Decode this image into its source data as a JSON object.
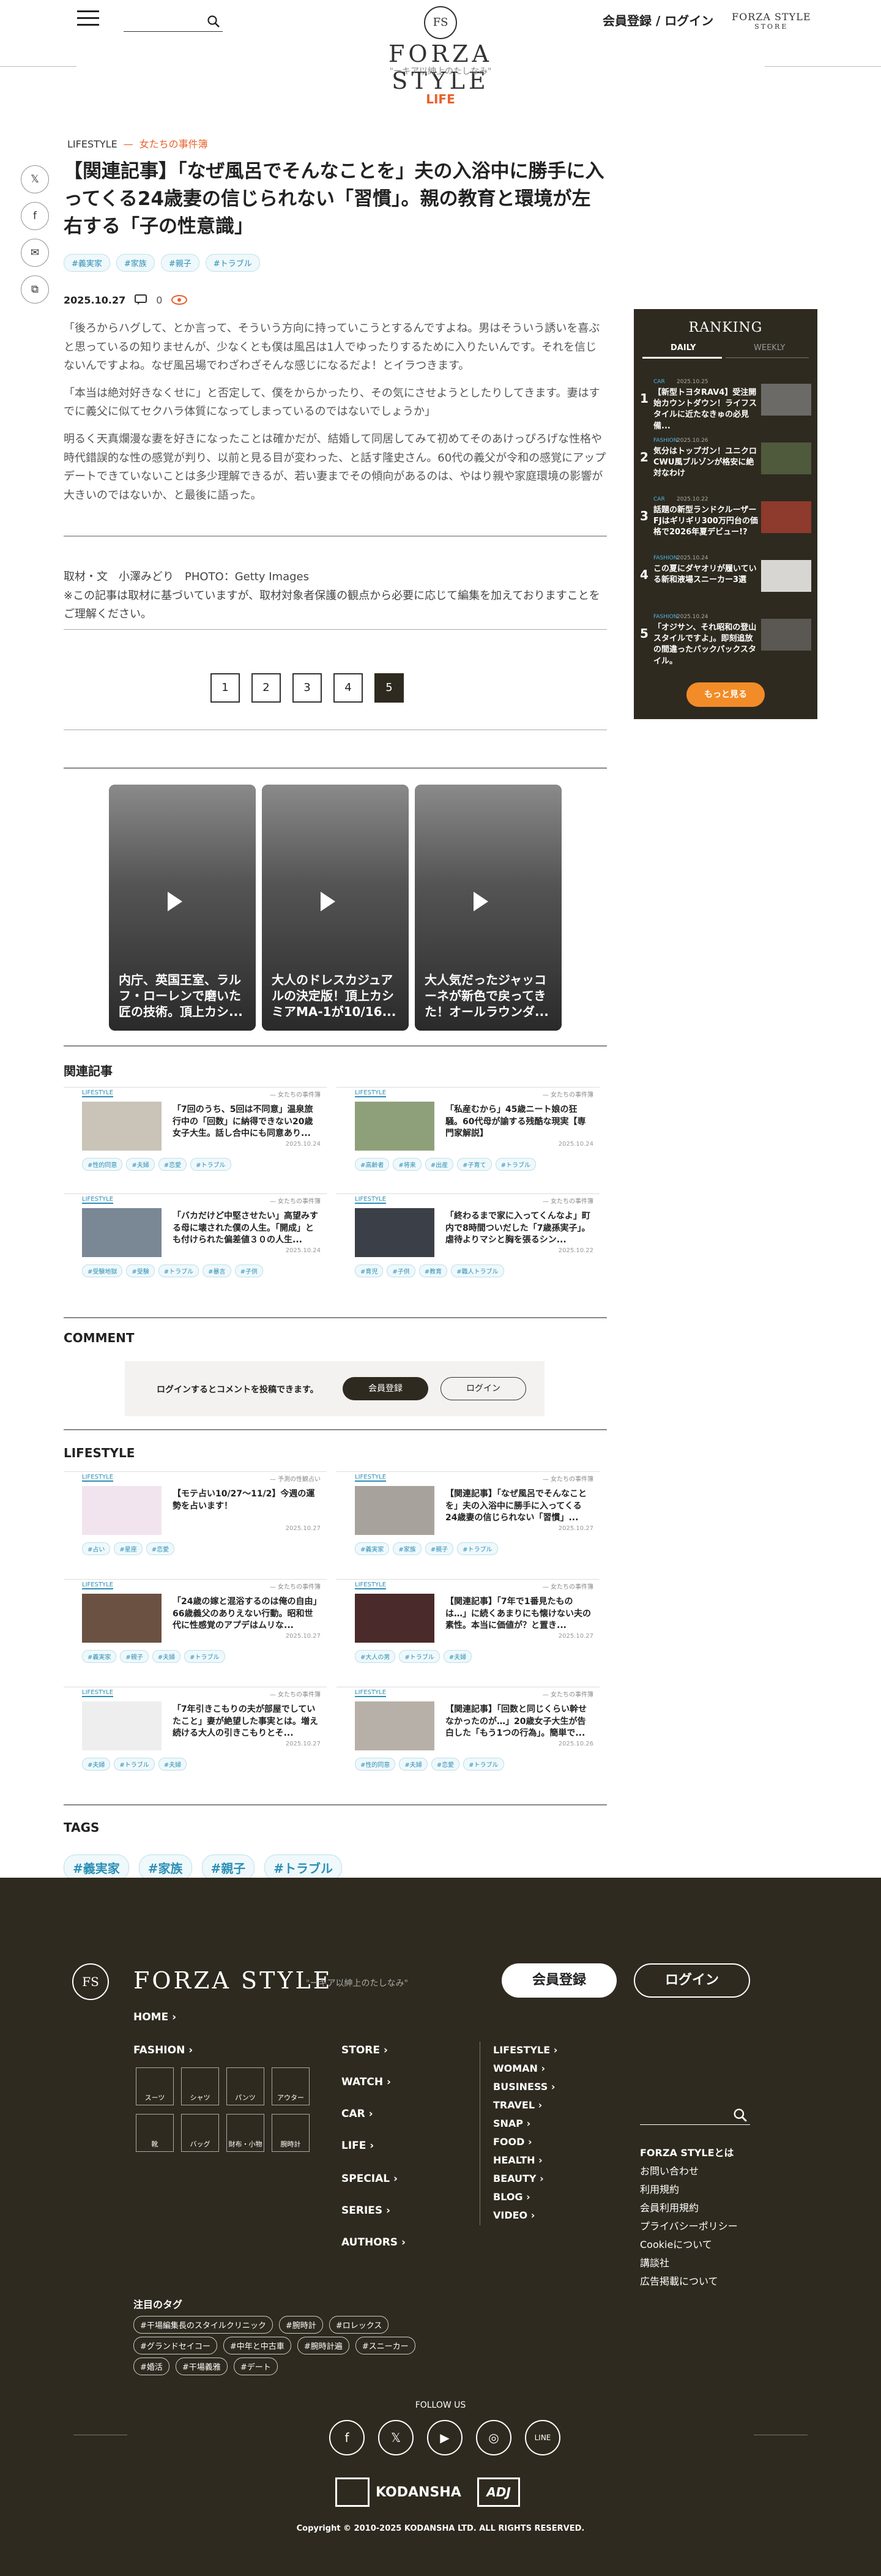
{
  "header": {
    "logo_mark": "FS",
    "logo_text": "FORZA STYLE",
    "logo_sub": "\"ーキア以紳上のたしなみ\"",
    "signup": "会員登録",
    "slash": "/",
    "login": "ログイン",
    "store_line1": "FORZA STYLE",
    "store_line2": "STORE",
    "section": "LIFE"
  },
  "share": [
    "𝕏",
    "f",
    "✉",
    "⧉"
  ],
  "article": {
    "category": "LIFESTYLE",
    "subcategory": "女たちの事件簿",
    "title": "【関連記事】「なぜ風呂でそんなことを」夫の入浴中に勝手に入ってくる24歳妻の信じられない「習慣」。親の教育と環境が左右する「子の性意識」",
    "tags": [
      "#義実家",
      "#家族",
      "#親子",
      "#トラブル"
    ],
    "date": "2025.10.27",
    "comment_count": "0",
    "paragraphs": [
      "「後ろからハグして、とか言って、そういう方向に持っていこうとするんですよね。男はそういう誘いを喜ぶと思っているの知りませんが、少なくとも僕は風呂は1人でゆったりするために入りたいんです。それを信じないんですよね。なぜ風呂場でわざわざそんな感じになるだよ！とイラつきます。",
      "「本当は絶対好きなくせに」と否定して、僕をからかったり、その気にさせようとしたりしてきます。妻はすでに義父に似てセクハラ体質になってしまっているのではないでしょうか」",
      "明るく天真爛漫な妻を好きになったことは確かだが、結婚して同居してみて初めてそのあけっぴろげな性格や時代錯誤的な性の感覚が判り、以前と見る目が変わった、と話す隆史さん。60代の義父が令和の感覚にアップデートできていないことは多少理解できるが、若い妻までその傾向があるのは、やはり親や家庭環境の影響が大きいのではないか、と最後に語った。"
    ],
    "credit": "取材・文　小澤みどり　PHOTO：Getty Images",
    "note": "※この記事は取材に基づいていますが、取材対象者保護の観点から必要に応じて編集を加えておりますことをご理解ください。",
    "pages": [
      "1",
      "2",
      "3",
      "4",
      "5"
    ]
  },
  "videos": [
    {
      "caption": "内庁、英国王室、ラルフ・ローレンで磨いた匠の技術。頂上カシ..."
    },
    {
      "caption": "大人のドレスカジュアルの決定版！頂上カシミアMA-1が10/16..."
    },
    {
      "caption": "大人気だったジャッコーネが新色で戻ってきた！オールラウンダ..."
    }
  ],
  "related": {
    "heading": "関連記事",
    "items": [
      {
        "kind": "LIFESTYLE",
        "sub": "— 女たちの事件簿",
        "title": "「7回のうち、5回は不同意」温泉旅行中の「回数」に納得できない20歳女子大生。話し合中にも同意あり...",
        "date": "2025.10.24",
        "tags": [
          "#性的同意",
          "#夫婦",
          "#恋愛",
          "#トラブル"
        ]
      },
      {
        "kind": "LIFESTYLE",
        "sub": "— 女たちの事件簿",
        "title": "「私産むから」45歳ニート娘の狂騒。60代母が諭する残酷な現実【専門家解説】",
        "date": "2025.10.24",
        "tags": [
          "#高齢者",
          "#将来",
          "#出産",
          "#子育て",
          "#トラブル"
        ]
      },
      {
        "kind": "LIFESTYLE",
        "sub": "— 女たちの事件簿",
        "title": "「バカだけど中堅させたい」高望みする母に壊された僕の人生。「開成」とも付けられた偏差値３０の人生...",
        "date": "2025.10.24",
        "tags": [
          "#受験地獄",
          "#受験",
          "#トラブル",
          "#暴言",
          "#子供"
        ]
      },
      {
        "kind": "LIFESTYLE",
        "sub": "— 女たちの事件簿",
        "title": "「終わるまで家に入ってくんなよ」町内で8時間ついだした「7歳孫実子」。虐待よりマシと胸を張るシン...",
        "date": "2025.10.22",
        "tags": [
          "#育児",
          "#子供",
          "#教育",
          "#職人トラブル"
        ]
      }
    ]
  },
  "comment": {
    "heading": "COMMENT",
    "message": "ログインするとコメントを投稿できます。",
    "signup": "会員登録",
    "login": "ログイン"
  },
  "lifestyle": {
    "heading": "LIFESTYLE",
    "items": [
      {
        "kind": "LIFESTYLE",
        "sub": "— 予測の性観占い",
        "title": "【モテ占い10/27〜11/2】今週の運勢を占います！",
        "date": "2025.10.27",
        "tags": [
          "#占い",
          "#星座",
          "#恋愛"
        ]
      },
      {
        "kind": "LIFESTYLE",
        "sub": "— 女たちの事件簿",
        "title": "【関連記事】「なぜ風呂でそんなことを」夫の入浴中に勝手に入ってくる24歳妻の信じられない「習慣」...",
        "date": "2025.10.27",
        "tags": [
          "#義実家",
          "#家族",
          "#親子",
          "#トラブル"
        ]
      },
      {
        "kind": "LIFESTYLE",
        "sub": "— 女たちの事件簿",
        "title": "「24歳の嫁と混浴するのは俺の自由」66歳義父のありえない行動。昭和世代に性感覚のアプデはムリな...",
        "date": "2025.10.27",
        "tags": [
          "#義実家",
          "#親子",
          "#夫婦",
          "#トラブル"
        ]
      },
      {
        "kind": "LIFESTYLE",
        "sub": "— 女たちの事件簿",
        "title": "【関連記事】「7年で1番見たものは…」に続くあまりにも懐けない夫の素性。本当に価値が？と置き...",
        "date": "2025.10.27",
        "tags": [
          "#大人の男",
          "#トラブル",
          "#夫婦"
        ]
      },
      {
        "kind": "LIFESTYLE",
        "sub": "— 女たちの事件簿",
        "title": "「7年引きこもりの夫が部屋でしていたこと」妻が絶望した事実とは。増え続ける大人の引きこもりとそ...",
        "date": "2025.10.27",
        "tags": [
          "#夫婦",
          "#トラブル",
          "#夫婦"
        ]
      },
      {
        "kind": "LIFESTYLE",
        "sub": "— 女たちの事件簿",
        "title": "【関連記事】「回数と同じくらい幹せなかったのが…」20歳女子大生が告白した「もう1つの行為」。簡単で...",
        "date": "2025.10.26",
        "tags": [
          "#性的同意",
          "#夫婦",
          "#恋愛",
          "#トラブル"
        ]
      }
    ]
  },
  "tags_section": {
    "heading": "TAGS",
    "tags": [
      "#義実家",
      "#家族",
      "#親子",
      "#トラブル"
    ]
  },
  "ranking": {
    "title": "RANKING",
    "tab_daily": "DAILY",
    "tab_weekly": "WEEKLY",
    "more": "もっと見る",
    "items": [
      {
        "n": "1",
        "cat": "CAR",
        "date": "2025.10.25",
        "title": "【新型トヨタRAV4】受注開始カウントダウン！ライフスタイルに近たなきゅの必見備..."
      },
      {
        "n": "2",
        "cat": "FASHION",
        "date": "2025.10.26",
        "title": "気分はトップガン！ユニクロCWU風ブルゾンが格安に絶対なわけ"
      },
      {
        "n": "3",
        "cat": "CAR",
        "date": "2025.10.22",
        "title": "話題の新型ランドクルーザー FJはギリギリ300万円台の価格で2026年夏デビュー!?"
      },
      {
        "n": "4",
        "cat": "FASHION",
        "date": "2025.10.24",
        "title": "この夏にダヤオリが履いている新和液場スニーカー3選"
      },
      {
        "n": "5",
        "cat": "FASHION",
        "date": "2025.10.24",
        "title": "「オジサン、それ昭和の登山スタイルですよ」。即刻追放の間違ったバックパックスタイル。"
      }
    ]
  },
  "footer": {
    "logo_mark": "FS",
    "logo_text": "FORZA STYLE",
    "logo_sub": "\"ーキア以紳上のたしなみ\"",
    "signup": "会員登録",
    "login": "ログイン",
    "home": "HOME",
    "fashion": "FASHION",
    "fashion_icons": [
      "スーツ",
      "シャツ",
      "パンツ",
      "アウター",
      "靴",
      "バッグ",
      "財布・小物",
      "腕時計"
    ],
    "col2": [
      "STORE",
      "WATCH",
      "CAR",
      "LIFE",
      "SPECIAL",
      "SERIES",
      "AUTHORS"
    ],
    "col3": [
      "LIFESTYLE",
      "WOMAN",
      "BUSINESS",
      "TRAVEL",
      "SNAP",
      "FOOD",
      "HEALTH",
      "BEAUTY",
      "BLOG",
      "VIDEO"
    ],
    "links": [
      "FORZA STYLEとは",
      "お問い合わせ",
      "利用規約",
      "会員利用規約",
      "プライバシーポリシー",
      "Cookieについて",
      "講談社",
      "広告掲載について"
    ],
    "tags_head": "注目のタグ",
    "tags": [
      "#干場編集長のスタイルクリニック",
      "#腕時計",
      "#ロレックス",
      "#グランドセイコー",
      "#中年と中古車",
      "#腕時計遍",
      "#スニーカー",
      "#婚活",
      "#干場義雅",
      "#デート"
    ],
    "follow": "FOLLOW US",
    "socials": [
      "f",
      "𝕏",
      "▶",
      "◎",
      "LINE"
    ],
    "kodansha": "KODANSHA",
    "adj": "ADJ",
    "copyright": "Copyright © 2010-2025 KODANSHA LTD. ALL RIGHTS RESERVED."
  }
}
